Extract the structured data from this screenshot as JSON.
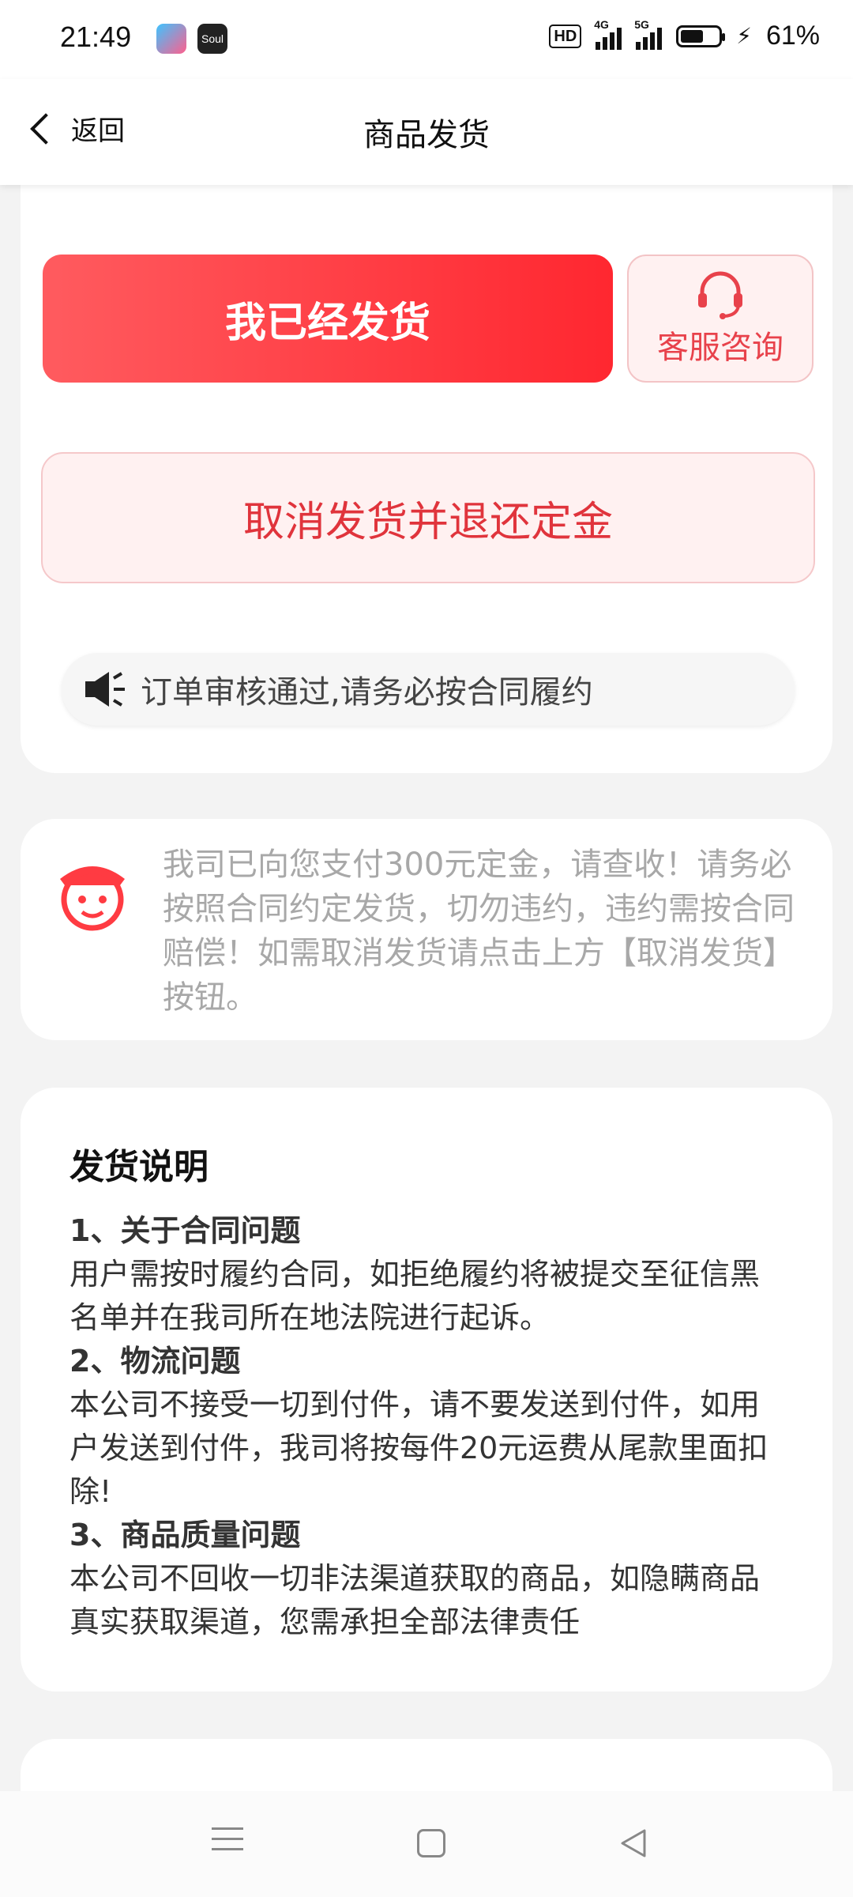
{
  "status_bar": {
    "time": "21:49",
    "app2_label": "Soul",
    "hd_label": "HD",
    "net1": "4G",
    "net2": "5G",
    "battery_percent": "61%",
    "battery_level": 0.61
  },
  "header": {
    "back_label": "返回",
    "title": "商品发货"
  },
  "actions": {
    "shipped_label": "我已经发货",
    "service_label": "客服咨询",
    "cancel_label": "取消发货并退还定金",
    "notice_text": "订单审核通过,请务必按合同履约"
  },
  "message": {
    "text": "我司已向您支付300元定金，请查收！请务必按照合同约定发货，切勿违约，违约需按合同赔偿！如需取消发货请点击上方【取消发货】按钮。"
  },
  "instructions": {
    "title": "发货说明",
    "items": [
      {
        "heading": "1、关于合同问题",
        "body": "用户需按时履约合同，如拒绝履约将被提交至征信黑名单并在我司所在地法院进行起诉。"
      },
      {
        "heading": "2、物流问题",
        "body": "本公司不接受一切到付件，请不要发送到付件，如用户发送到付件，我司将按每件20元运费从尾款里面扣除!"
      },
      {
        "heading": "3、商品质量问题",
        "body": "本公司不回收一切非法渠道获取的商品，如隐瞒商品真实获取渠道，您需承担全部法律责任"
      }
    ]
  },
  "colors": {
    "accent": "#ff2730",
    "accent_text": "#e0343c",
    "soft_bg": "#fff1f1"
  },
  "icons": [
    "back-chevron-icon",
    "headset-icon",
    "speaker-icon",
    "agent-avatar-icon",
    "menu-icon",
    "home-icon",
    "back-triangle-icon"
  ]
}
